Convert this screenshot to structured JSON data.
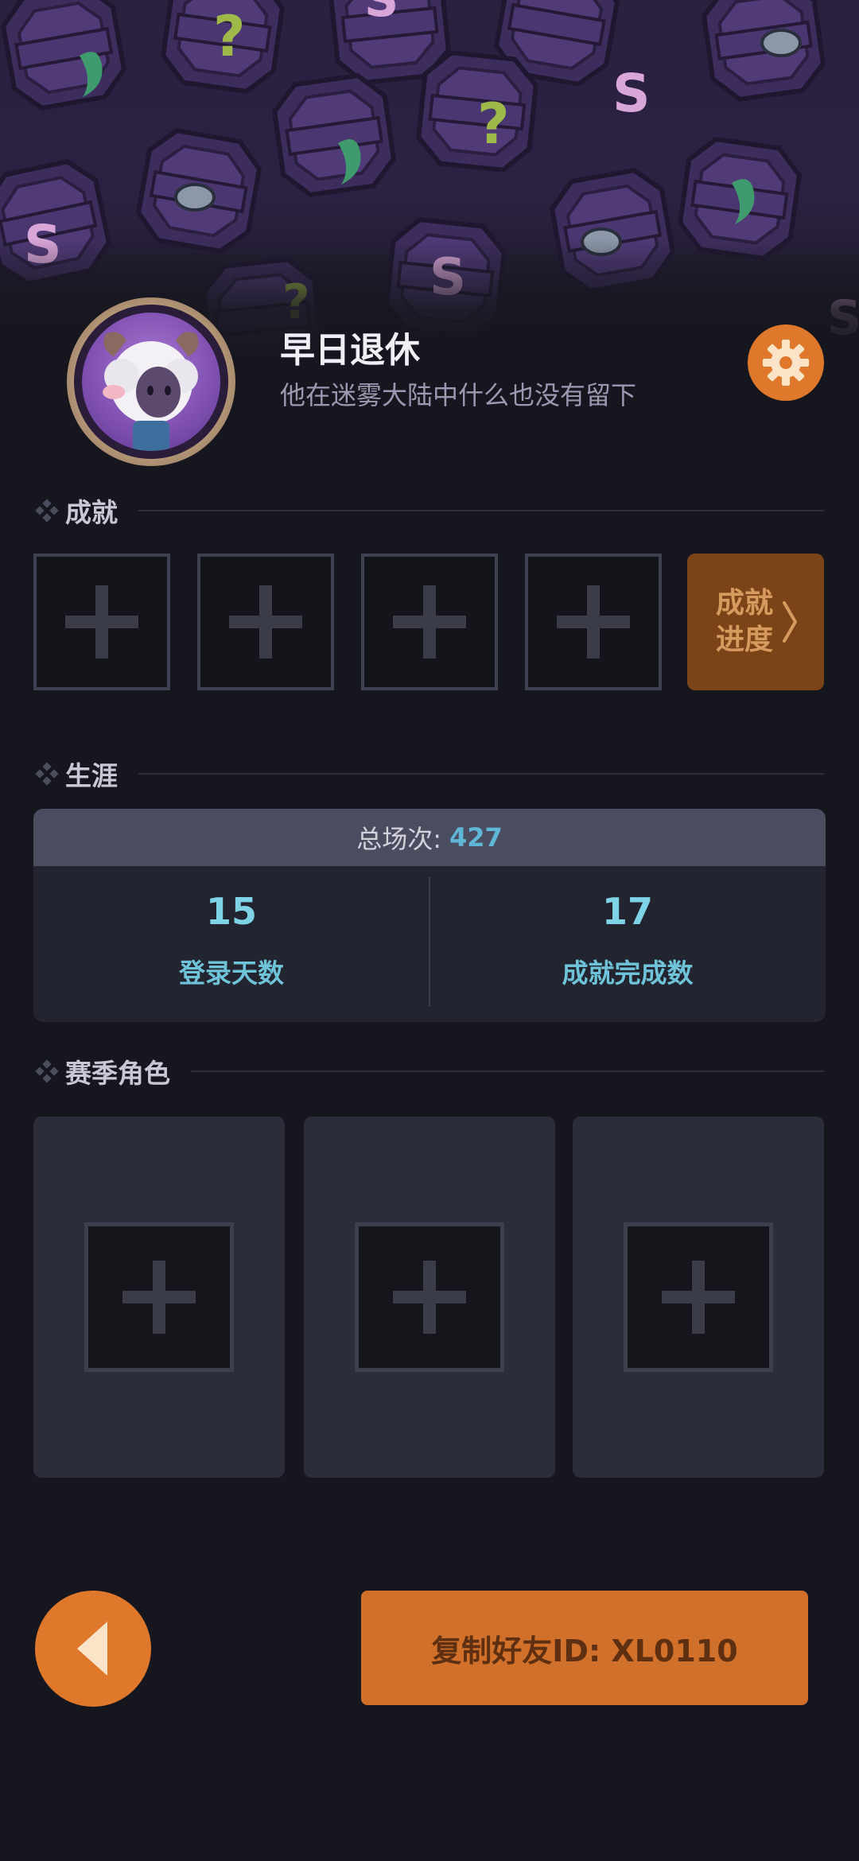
{
  "profile": {
    "name": "早日退休",
    "bio": "他在迷雾大陆中什么也没有留下"
  },
  "achievements": {
    "title": "成就",
    "slot_count": 4,
    "progress_button_label": "成就进度"
  },
  "career": {
    "title": "生涯",
    "total_label": "总场次:",
    "total_value": "427",
    "stats": [
      {
        "value": "15",
        "label": "登录天数"
      },
      {
        "value": "17",
        "label": "成就完成数"
      }
    ]
  },
  "season_roles": {
    "title": "赛季角色",
    "slot_count": 3
  },
  "footer": {
    "copy_button_label": "复制好友ID: XL0110"
  },
  "icons": {
    "settings": "gear-icon",
    "back": "back-arrow-icon",
    "section": "diamond-icon",
    "add": "plus-icon",
    "chevron": "chevron-right-icon"
  },
  "colors": {
    "accent": "#e0782c",
    "background": "#16171e",
    "stat_number": "#7fd3e6",
    "stat_label": "#6fc3d8",
    "total_value": "#5fb6d6"
  }
}
